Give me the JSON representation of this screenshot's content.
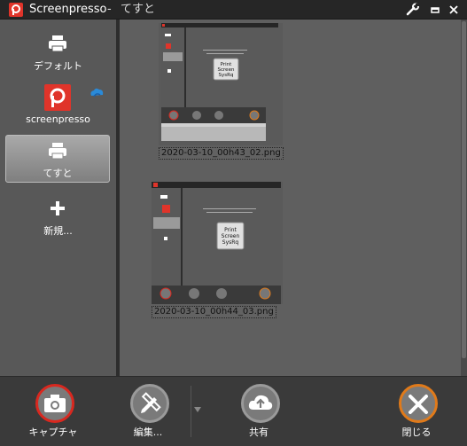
{
  "window": {
    "app_title": "Screenpresso",
    "separator": "-",
    "doc_title": "てすと"
  },
  "sidebar": {
    "items": [
      {
        "label": "デフォルト",
        "icon": "printer-icon"
      },
      {
        "label": "screenpresso",
        "icon": "screenpresso-logo-icon"
      },
      {
        "label": "てすと",
        "icon": "printer-icon",
        "selected": true
      },
      {
        "label": "新規...",
        "icon": "plus-icon"
      }
    ]
  },
  "screenshots": [
    {
      "filename": "2020-03-10_00h43_02.png"
    },
    {
      "filename": "2020-03-10_00h44_03.png"
    }
  ],
  "thumb_content": {
    "title": "Screenpresso",
    "key_line1": "Print",
    "key_line2": "Screen",
    "key_line3": "SysRq"
  },
  "toolbar": {
    "capture_label": "キャプチャ",
    "edit_label": "編集...",
    "share_label": "共有",
    "close_label": "閉じる"
  },
  "colors": {
    "capture_ring": "#d9281f",
    "close_ring": "#e07a1a",
    "brand_red": "#e0342a"
  }
}
